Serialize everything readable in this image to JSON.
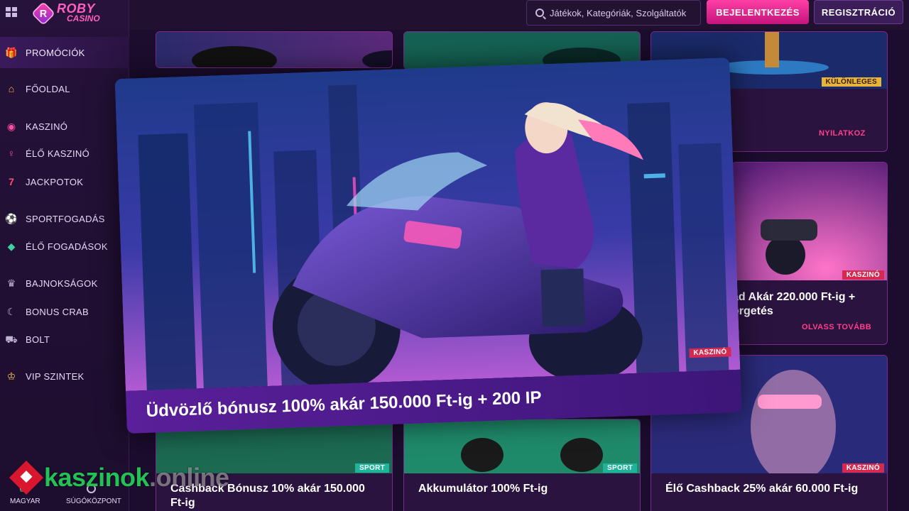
{
  "app": {
    "logo_line1": "ROBY",
    "logo_line2": "CASINO",
    "logo_badge": "R"
  },
  "header": {
    "search_placeholder": "Játékok, Kategóriák, Szolgáltatók",
    "login_label": "BEJELENTKEZÉS",
    "register_label": "REGISZTRÁCIÓ"
  },
  "sidebar": {
    "promo": {
      "label": "PROMÓCIÓK",
      "icon": "gift-icon"
    },
    "items": [
      {
        "label": "FŐOLDAL",
        "icon": "home-icon"
      },
      {
        "label": "KASZINÓ",
        "icon": "casino-chip-icon"
      },
      {
        "label": "ÉLŐ KASZINÓ",
        "icon": "microphone-icon"
      },
      {
        "label": "JACKPOTOK",
        "icon": "seven-icon"
      },
      {
        "label": "SPORTFOGADÁS",
        "icon": "soccer-ball-icon"
      },
      {
        "label": "ÉLŐ FOGADÁSOK",
        "icon": "ticket-icon"
      },
      {
        "label": "BAJNOKSÁGOK",
        "icon": "trophy-icon"
      },
      {
        "label": "BONUS CRAB",
        "icon": "crab-claw-icon"
      },
      {
        "label": "BOLT",
        "icon": "cart-icon"
      },
      {
        "label": "VIP SZINTEK",
        "icon": "crown-icon"
      }
    ],
    "footer": {
      "language": "MAGYAR",
      "help": "SÚGÓKÖZPONT"
    }
  },
  "watermark": {
    "brand": "kaszinok",
    "suffix": ".online"
  },
  "banner": {
    "title": "Üdvözlő bónusz 100% akár 150.000 Ft-ig + 200 IP",
    "tag": "KASZINÓ"
  },
  "cards": {
    "top_right": {
      "tag": "KÜLÖNLEGES",
      "link": "NYILATKOZ"
    },
    "mid_right": {
      "tag": "KASZINÓ",
      "title_line1": "ad Akár 220.000 Ft-ig +",
      "title_line2": "orgetés",
      "link": "OLVASS TOVÁBB"
    },
    "bottom_left": {
      "tag": "SPORT",
      "title_line1": "Cashback Bónusz 10% akár 150.000",
      "title_line2": "Ft-ig"
    },
    "bottom_mid": {
      "tag": "SPORT",
      "title_line1": "Akkumulátor 100% Ft-ig"
    },
    "bottom_right": {
      "tag": "KASZINÓ",
      "title_line1": "Élő Cashback 25% akár 60.000 Ft-ig"
    }
  },
  "colors": {
    "accent_pink": "#ff3fa6",
    "sport_tag": "#1fb39b",
    "casino_tag": "#d52952",
    "special_tag": "#e5b53b"
  }
}
